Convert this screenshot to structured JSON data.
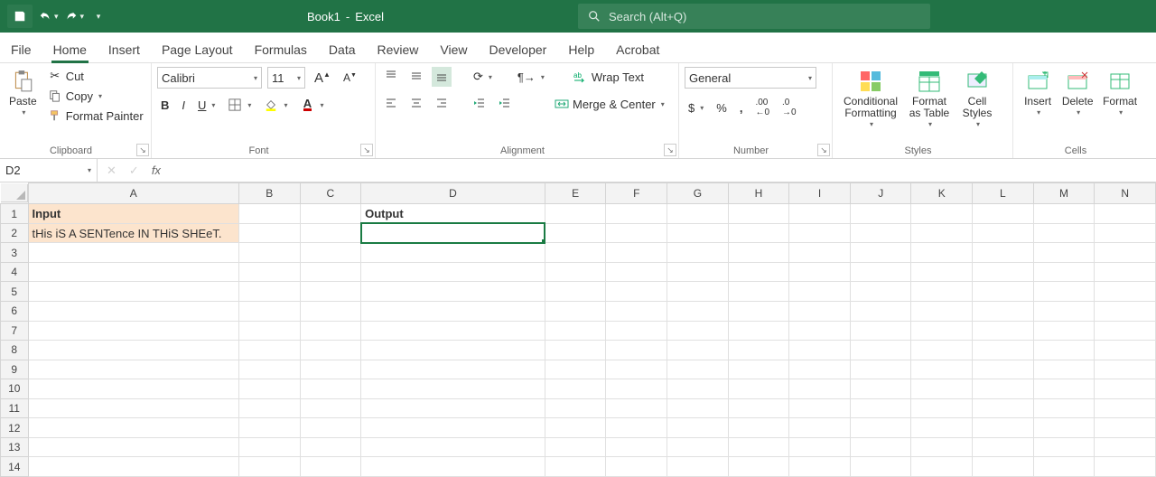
{
  "titlebar": {
    "doc": "Book1",
    "app": "Excel",
    "title_sep": " - "
  },
  "search": {
    "placeholder": "Search (Alt+Q)"
  },
  "tabs": {
    "file": "File",
    "home": "Home",
    "insert": "Insert",
    "page_layout": "Page Layout",
    "formulas": "Formulas",
    "data": "Data",
    "review": "Review",
    "view": "View",
    "developer": "Developer",
    "help": "Help",
    "acrobat": "Acrobat"
  },
  "ribbon": {
    "clipboard": {
      "label": "Clipboard",
      "paste": "Paste",
      "cut": "Cut",
      "copy": "Copy",
      "format_painter": "Format Painter"
    },
    "font": {
      "label": "Font",
      "name": "Calibri",
      "size": "11"
    },
    "alignment": {
      "label": "Alignment",
      "wrap": "Wrap Text",
      "merge": "Merge & Center"
    },
    "number": {
      "label": "Number",
      "format": "General"
    },
    "styles": {
      "label": "Styles",
      "conditional": "Conditional Formatting",
      "format_as_table": "Format as Table",
      "cell_styles": "Cell Styles"
    },
    "cells": {
      "label": "Cells",
      "insert": "Insert",
      "delete": "Delete",
      "format": "Format"
    }
  },
  "formula_bar": {
    "name_box": "D2",
    "formula": ""
  },
  "grid": {
    "columns": [
      "A",
      "B",
      "C",
      "D",
      "E",
      "F",
      "G",
      "H",
      "I",
      "J",
      "K",
      "L",
      "M",
      "N"
    ],
    "row_count": 14,
    "col_widths": {
      "A": "colA",
      "D": "colD"
    },
    "selected_cell": "D2",
    "cells": {
      "A1": {
        "value": "Input",
        "classes": "filled-orange bold"
      },
      "A2": {
        "value": "tHis iS A SENTence IN THiS SHEeT.",
        "classes": "filled-orange"
      },
      "D1": {
        "value": "Output",
        "classes": "bold"
      }
    }
  }
}
